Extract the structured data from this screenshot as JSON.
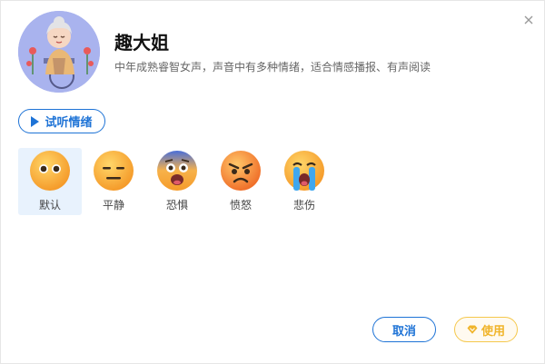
{
  "voice": {
    "name": "趣大姐",
    "description": "中年成熟睿智女声，声音中有多种情绪，适合情感播报、有声阅读"
  },
  "listen_button": {
    "label": "试听情绪",
    "icon": "play-icon"
  },
  "emotions": [
    {
      "label": "默认",
      "icon": "neutral-face-icon",
      "selected": true
    },
    {
      "label": "平静",
      "icon": "expressionless-face-icon",
      "selected": false
    },
    {
      "label": "恐惧",
      "icon": "fearful-face-icon",
      "selected": false
    },
    {
      "label": "愤怒",
      "icon": "angry-face-icon",
      "selected": false
    },
    {
      "label": "悲伤",
      "icon": "crying-face-icon",
      "selected": false
    }
  ],
  "footer": {
    "cancel_label": "取消",
    "use_label": "使用",
    "use_icon": "diamond-icon"
  },
  "colors": {
    "accent": "#1e73d6",
    "vip": "#f0b429",
    "selected_bg": "#e8f2fd",
    "avatar_bg": "#a9b3ee"
  }
}
